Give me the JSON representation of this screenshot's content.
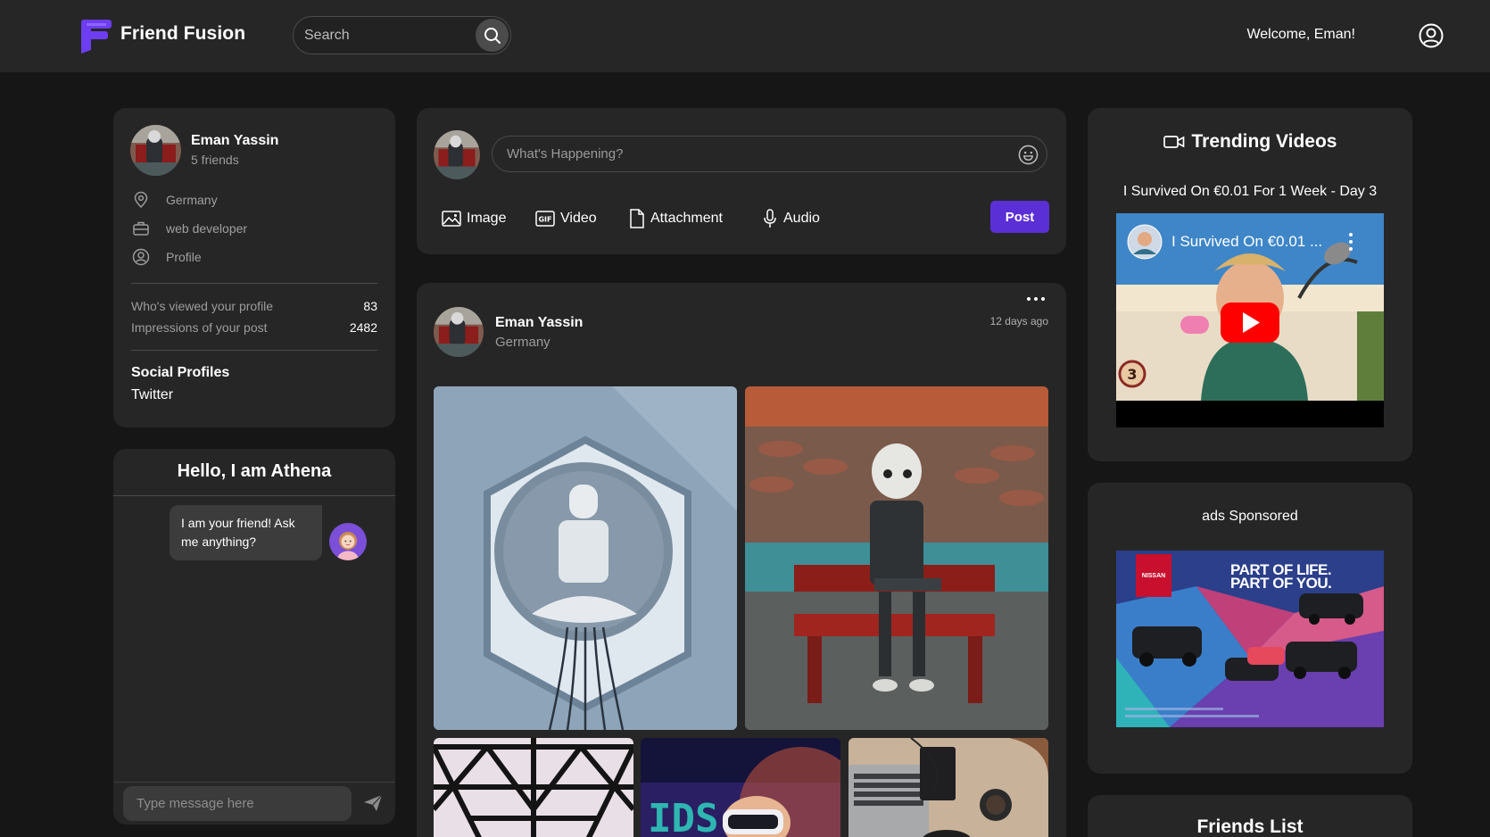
{
  "header": {
    "brand": "Friend Fusion",
    "search_placeholder": "Search",
    "welcome": "Welcome, Eman!"
  },
  "profile": {
    "name": "Eman Yassin",
    "friends": "5 friends",
    "info": [
      {
        "icon": "location-icon",
        "text": "Germany"
      },
      {
        "icon": "briefcase-icon",
        "text": "web developer"
      },
      {
        "icon": "profile-icon",
        "text": "Profile"
      }
    ],
    "stats": [
      {
        "label": "Who's viewed your profile",
        "value": "83"
      },
      {
        "label": "Impressions of your post",
        "value": "2482"
      }
    ],
    "social_title": "Social Profiles",
    "social_links": [
      "Twitter"
    ]
  },
  "chatbot": {
    "title": "Hello, I am Athena",
    "message": "I am your friend! Ask me anything?",
    "input_placeholder": "Type message here"
  },
  "composer": {
    "placeholder": "What's Happening?",
    "tools": [
      {
        "icon": "image-icon",
        "label": "Image"
      },
      {
        "icon": "gif-icon",
        "label": "Video"
      },
      {
        "icon": "file-icon",
        "label": "Attachment"
      },
      {
        "icon": "microphone-icon",
        "label": "Audio"
      }
    ],
    "post_label": "Post"
  },
  "feed": {
    "post": {
      "author": "Eman Yassin",
      "location": "Germany",
      "time": "12 days ago"
    }
  },
  "trending": {
    "title": "Trending Videos",
    "video_caption": "I Survived On €0.01 For 1 Week - Day 3",
    "video_overlay_title": "I Survived On €0.01 ...",
    "video_badge": "3"
  },
  "ads": {
    "title": "ads Sponsored",
    "headline_line1": "PART OF LIFE.",
    "headline_line2": "PART OF YOU.",
    "brand": "NISSAN"
  },
  "friends": {
    "title": "Friends List"
  },
  "colors": {
    "background": "#161616",
    "card": "#262626",
    "accent": "#5b2fd6",
    "logo": "#6d3df2"
  }
}
